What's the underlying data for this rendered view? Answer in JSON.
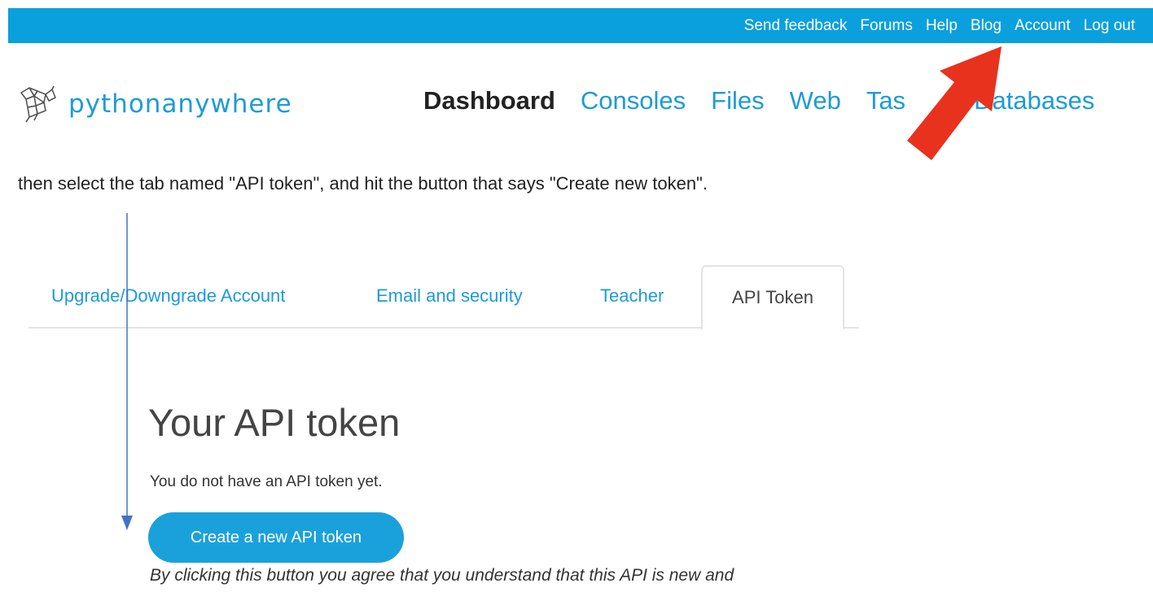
{
  "top_bar": {
    "links": [
      "Send feedback",
      "Forums",
      "Help",
      "Blog",
      "Account",
      "Log out"
    ]
  },
  "logo": {
    "text": "pythonanywhere",
    "icon": "python-snake-logo-icon"
  },
  "main_nav": {
    "items": [
      "Dashboard",
      "Consoles",
      "Files",
      "Web",
      "Tas",
      "Databases"
    ],
    "active": "Dashboard"
  },
  "instruction": {
    "text": "then select the tab named \"API token\", and hit the button that says \"Create new token\"."
  },
  "tabs": {
    "items": [
      "Upgrade/Downgrade Account",
      "Email and security",
      "Teacher",
      "API Token"
    ],
    "active": "API Token"
  },
  "token_section": {
    "heading": "Your API token",
    "status": "You do not have an API token yet.",
    "create_button": "Create a new API token",
    "disclaimer": "By clicking this button you agree that you understand that this API is new and"
  },
  "colors": {
    "brand_blue": "#0aa0dd",
    "link_blue": "#1d9bd7",
    "arrow_red": "#e8321e",
    "annotation_blue": "#4472c4"
  }
}
